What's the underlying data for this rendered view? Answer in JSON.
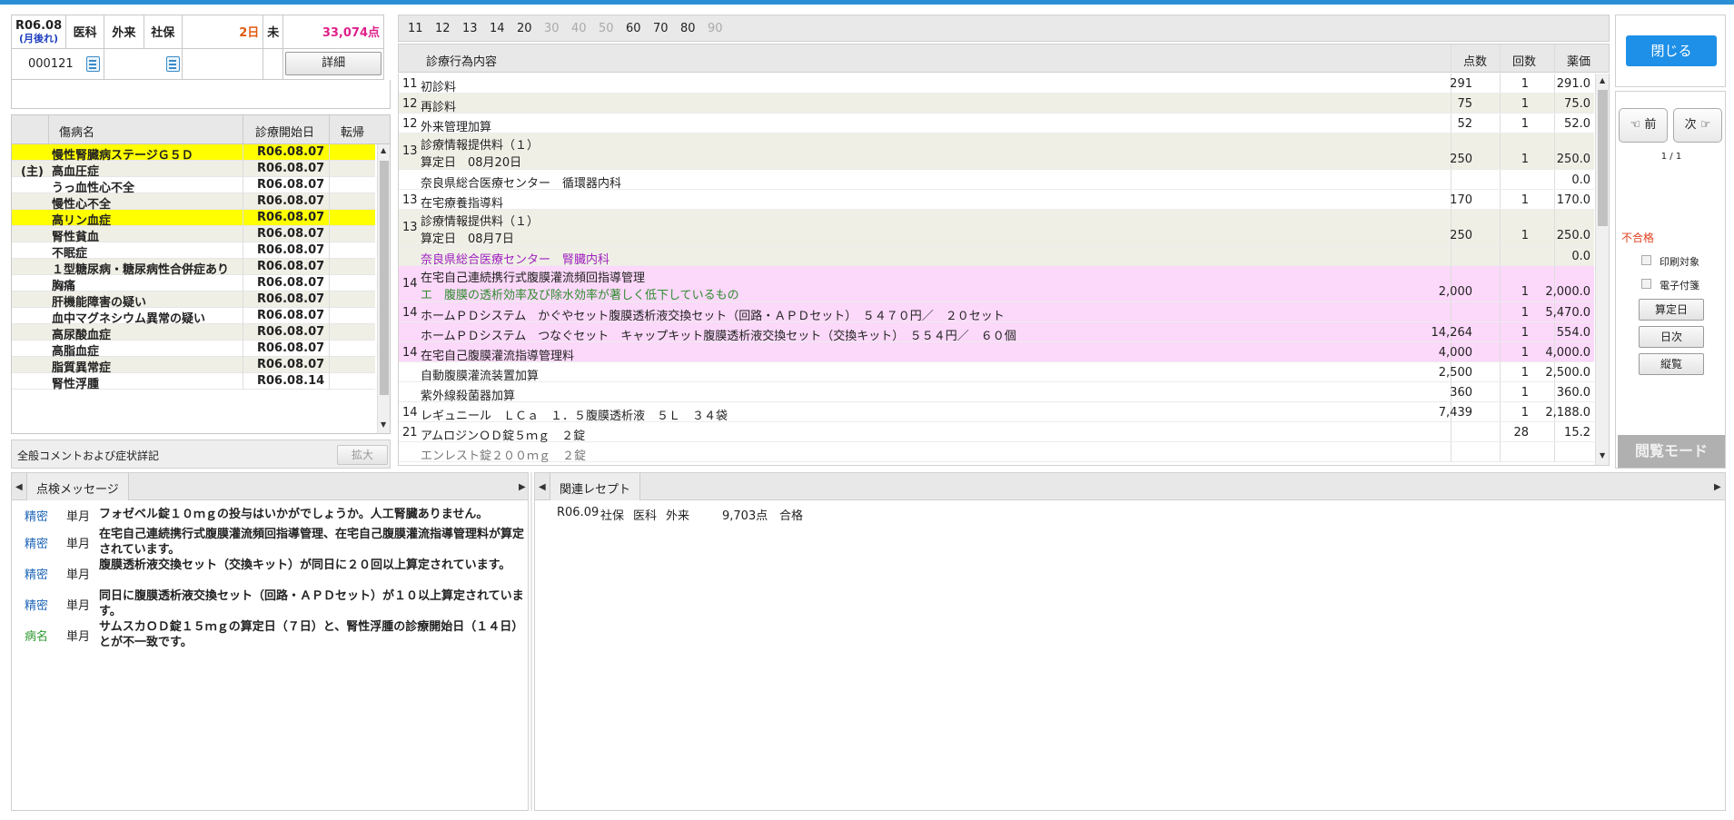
{
  "header": {
    "date": "R06.08",
    "date_note": "(月後れ)",
    "type1": "医科",
    "type2": "外来",
    "insurance": "社保",
    "days": "2日",
    "status": "未",
    "points": "33,074点",
    "id": "000121",
    "detail_button": "詳細"
  },
  "diseases": {
    "col_name": "傷病名",
    "col_date": "診療開始日",
    "col_outcome": "転帰",
    "rows": [
      {
        "mark": "",
        "name": "慢性腎臓病ステージＧ５Ｄ",
        "date": "R06.08.07",
        "highlight": "yellow"
      },
      {
        "mark": "(主)",
        "name": "高血圧症",
        "date": "R06.08.07",
        "highlight": "alt"
      },
      {
        "mark": "",
        "name": "うっ血性心不全",
        "date": "R06.08.07",
        "highlight": "none"
      },
      {
        "mark": "",
        "name": "慢性心不全",
        "date": "R06.08.07",
        "highlight": "alt"
      },
      {
        "mark": "",
        "name": "高リン血症",
        "date": "R06.08.07",
        "highlight": "yellow"
      },
      {
        "mark": "",
        "name": "腎性貧血",
        "date": "R06.08.07",
        "highlight": "alt"
      },
      {
        "mark": "",
        "name": "不眠症",
        "date": "R06.08.07",
        "highlight": "none"
      },
      {
        "mark": "",
        "name": "１型糖尿病・糖尿病性合併症あり",
        "date": "R06.08.07",
        "highlight": "alt"
      },
      {
        "mark": "",
        "name": "胸痛",
        "date": "R06.08.07",
        "highlight": "none"
      },
      {
        "mark": "",
        "name": "肝機能障害の疑い",
        "date": "R06.08.07",
        "highlight": "alt"
      },
      {
        "mark": "",
        "name": "血中マグネシウム異常の疑い",
        "date": "R06.08.07",
        "highlight": "none"
      },
      {
        "mark": "",
        "name": "高尿酸血症",
        "date": "R06.08.07",
        "highlight": "alt"
      },
      {
        "mark": "",
        "name": "高脂血症",
        "date": "R06.08.07",
        "highlight": "none"
      },
      {
        "mark": "",
        "name": "脂質異常症",
        "date": "R06.08.07",
        "highlight": "alt"
      },
      {
        "mark": "",
        "name": "腎性浮腫",
        "date": "R06.08.14",
        "highlight": "none"
      }
    ],
    "comment_label": "全般コメントおよび症状詳記",
    "expand_button": "拡大"
  },
  "tabs": [
    "11",
    "12",
    "13",
    "14",
    "20",
    "30",
    "40",
    "50",
    "60",
    "70",
    "80",
    "90"
  ],
  "tabs_dim": [
    "30",
    "40",
    "50",
    "90"
  ],
  "detail": {
    "col_name": "診療行為内容",
    "col_points": "点数",
    "col_count": "回数",
    "col_amount": "薬価",
    "rows": [
      {
        "code": "11",
        "lines": [
          "初診料"
        ],
        "points": "291",
        "count": "1",
        "amount": "291.0",
        "bg": "#ffffff",
        "color": "#222"
      },
      {
        "code": "12",
        "lines": [
          "再診料"
        ],
        "points": "75",
        "count": "1",
        "amount": "75.0",
        "bg": "#f0efe6",
        "color": "#222"
      },
      {
        "code": "12",
        "lines": [
          "外来管理加算"
        ],
        "points": "52",
        "count": "1",
        "amount": "52.0",
        "bg": "#ffffff",
        "color": "#222"
      },
      {
        "code": "13",
        "lines": [
          "診療情報提供料（１）",
          "算定日　08月20日"
        ],
        "points": "250",
        "count": "1",
        "amount": "250.0",
        "bg": "#f0efe6",
        "color": "#222"
      },
      {
        "code": "",
        "lines": [
          "奈良県総合医療センター　循環器内科"
        ],
        "points": "",
        "count": "",
        "amount": "0.0",
        "bg": "#ffffff",
        "color": "#222"
      },
      {
        "code": "13",
        "lines": [
          "在宅療養指導料"
        ],
        "points": "170",
        "count": "1",
        "amount": "170.0",
        "bg": "#ffffff",
        "color": "#222"
      },
      {
        "code": "13",
        "lines": [
          "診療情報提供料（１）",
          "算定日　08月7日"
        ],
        "points": "250",
        "count": "1",
        "amount": "250.0",
        "bg": "#f0efe6",
        "color": "#222"
      },
      {
        "code": "",
        "lines": [
          "奈良県総合医療センター　腎臓内科"
        ],
        "points": "",
        "count": "",
        "amount": "0.0",
        "bg": "#f0efe6",
        "color": "#a020c0"
      },
      {
        "code": "14",
        "lines": [
          "在宅自己連続携行式腹膜灌流頻回指導管理",
          "エ　腹膜の透析効率及び除水効率が著しく低下しているもの"
        ],
        "points": "2,000",
        "count": "1",
        "amount": "2,000.0",
        "bg": "#fcd8fa",
        "color": "#222"
      },
      {
        "code": "14",
        "lines": [
          "ホームＰＤシステム　かぐやセット腹膜透析液交換セット（回路・ＡＰＤセット）　５４７０円／　２０セット"
        ],
        "points": "",
        "count": "1",
        "amount": "5,470.0",
        "bg": "#fcd8fa",
        "color": "#222"
      },
      {
        "code": "",
        "lines": [
          "ホームＰＤシステム　つなぐセット　キャップキット腹膜透析液交換セット（交換キット）　５５４円／　６０個"
        ],
        "points": "14,264",
        "count": "1",
        "amount": "554.0",
        "bg": "#fcd8fa",
        "color": "#222"
      },
      {
        "code": "14",
        "lines": [
          "在宅自己腹膜灌流指導管理料"
        ],
        "points": "4,000",
        "count": "1",
        "amount": "4,000.0",
        "bg": "#fcd8fa",
        "color": "#222"
      },
      {
        "code": "",
        "lines": [
          "自動腹膜灌流装置加算"
        ],
        "points": "2,500",
        "count": "1",
        "amount": "2,500.0",
        "bg": "#ffffff",
        "color": "#222"
      },
      {
        "code": "",
        "lines": [
          "紫外線殺菌器加算"
        ],
        "points": "360",
        "count": "1",
        "amount": "360.0",
        "bg": "#ffffff",
        "color": "#222"
      },
      {
        "code": "14",
        "lines": [
          "レギュニール　ＬＣａ　１．５腹膜透析液　５Ｌ　３４袋"
        ],
        "points": "7,439",
        "count": "1",
        "amount": "2,188.0",
        "bg": "#ffffff",
        "color": "#222"
      },
      {
        "code": "21",
        "lines": [
          "アムロジンＯＤ錠５ｍｇ　２錠"
        ],
        "points": "",
        "count": "28",
        "amount": "15.2",
        "bg": "#ffffff",
        "color": "#222"
      },
      {
        "code": "",
        "lines": [
          "エンレスト錠２００ｍｇ　２錠"
        ],
        "points": "",
        "count": "",
        "amount": "",
        "bg": "#ffffff",
        "color": "#777"
      }
    ]
  },
  "right": {
    "close_button": "閉じる",
    "prev_button": "前",
    "next_button": "次",
    "page": "1 / 1",
    "result": "不合格",
    "print_label": "印刷対象",
    "efile_label": "電子付箋",
    "calc_date_button": "算定日",
    "daily_button": "日次",
    "vertical_button": "縦覧",
    "mode_label": "閲覧モード"
  },
  "check": {
    "tab_label": "点検メッセージ",
    "messages": [
      {
        "cat": "精密",
        "cat_color": "#1f66b8",
        "type": "単月",
        "text": "フォゼベル錠１０ｍｇの投与はいかがでしょうか。人工腎臓ありません。"
      },
      {
        "cat": "精密",
        "cat_color": "#1f66b8",
        "type": "単月",
        "text": "在宅自己連続携行式腹膜灌流頻回指導管理、在宅自己腹膜灌流指導管理料が算定されています。"
      },
      {
        "cat": "精密",
        "cat_color": "#1f66b8",
        "type": "単月",
        "text": "腹膜透析液交換セット（交換キット）が同日に２０回以上算定されています。"
      },
      {
        "cat": "精密",
        "cat_color": "#1f66b8",
        "type": "単月",
        "text": "同日に腹膜透析液交換セット（回路・ＡＰＤセット）が１０以上算定されています。"
      },
      {
        "cat": "病名",
        "cat_color": "#2f9a2f",
        "type": "単月",
        "text": "サムスカＯＤ錠１５ｍｇの算定日（７日）と、腎性浮腫の診療開始日（１４日）とが不一致です。"
      }
    ]
  },
  "related": {
    "tab_label": "関連レセプト",
    "rows": [
      {
        "date": "R06.09",
        "ins": "社保",
        "type1": "医科",
        "type2": "外来",
        "points": "9,703点",
        "status": "合格"
      }
    ]
  }
}
